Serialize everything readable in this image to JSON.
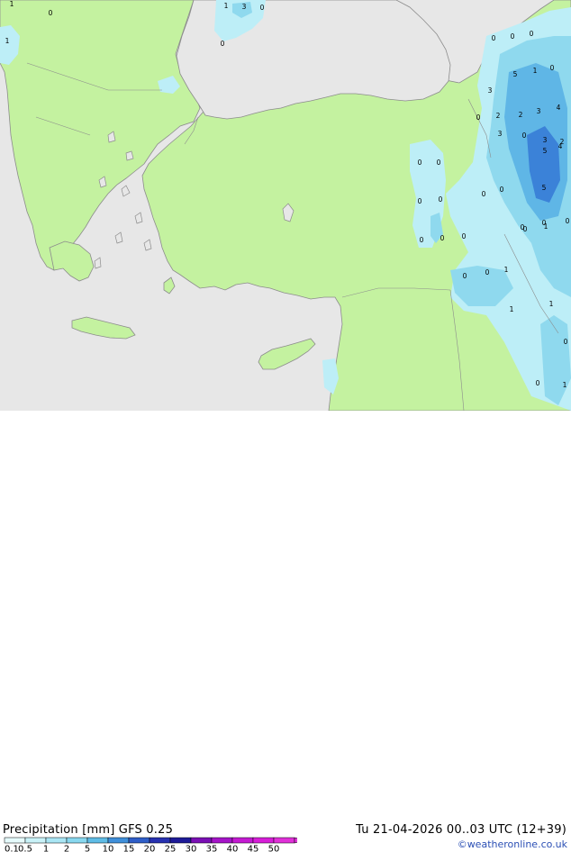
{
  "title": "Precipitation [mm]  GFS 0.25",
  "valid_time": "Tu 21-04-2026 00..03 UTC (12+39)",
  "credit": "©weatheronline.co.uk",
  "colors": {
    "sea": "#e7e7e7",
    "land": "#c4f2a0",
    "coast": "#8c8c8c",
    "precip_light": "#bdeef7",
    "precip_mid": "#8fd9ee",
    "precip_heavy": "#5fb6e6",
    "precip_core": "#3b82d8"
  },
  "legend": {
    "labels": [
      "0.1",
      "0.5",
      "1",
      "2",
      "5",
      "10",
      "15",
      "20",
      "25",
      "30",
      "35",
      "40",
      "45",
      "50"
    ],
    "colors": [
      "#e6fbfc",
      "#c9f2f8",
      "#a9e6f4",
      "#88d8ef",
      "#5fbce6",
      "#3f8fda",
      "#2f5ec8",
      "#2731b0",
      "#1e1a98",
      "#7a0fb4",
      "#a514c8",
      "#c41ad2",
      "#d71ed8",
      "#e030d8"
    ]
  },
  "map_labels": [
    {
      "text": "1"
    },
    {
      "text": "0"
    },
    {
      "text": "1"
    },
    {
      "text": "1"
    },
    {
      "text": "3"
    },
    {
      "text": "0"
    },
    {
      "text": "0"
    },
    {
      "text": "0"
    },
    {
      "text": "0"
    },
    {
      "text": "0"
    },
    {
      "text": "3"
    },
    {
      "text": "0"
    },
    {
      "text": "2"
    },
    {
      "text": "5"
    },
    {
      "text": "1"
    },
    {
      "text": "0"
    },
    {
      "text": "2"
    },
    {
      "text": "3"
    },
    {
      "text": "4"
    },
    {
      "text": "3"
    },
    {
      "text": "0"
    },
    {
      "text": "3"
    },
    {
      "text": "2"
    },
    {
      "text": "5"
    },
    {
      "text": "4"
    },
    {
      "text": "0"
    },
    {
      "text": "0"
    },
    {
      "text": "0"
    },
    {
      "text": "0"
    },
    {
      "text": "0"
    },
    {
      "text": "5"
    },
    {
      "text": "0"
    },
    {
      "text": "0"
    },
    {
      "text": "0"
    },
    {
      "text": "0"
    },
    {
      "text": "0"
    },
    {
      "text": "1"
    },
    {
      "text": "0"
    },
    {
      "text": "0"
    },
    {
      "text": "0"
    },
    {
      "text": "1"
    },
    {
      "text": "1"
    },
    {
      "text": "1"
    },
    {
      "text": "0"
    },
    {
      "text": "0"
    },
    {
      "text": "1"
    },
    {
      "text": "0"
    },
    {
      "text": "0"
    }
  ]
}
